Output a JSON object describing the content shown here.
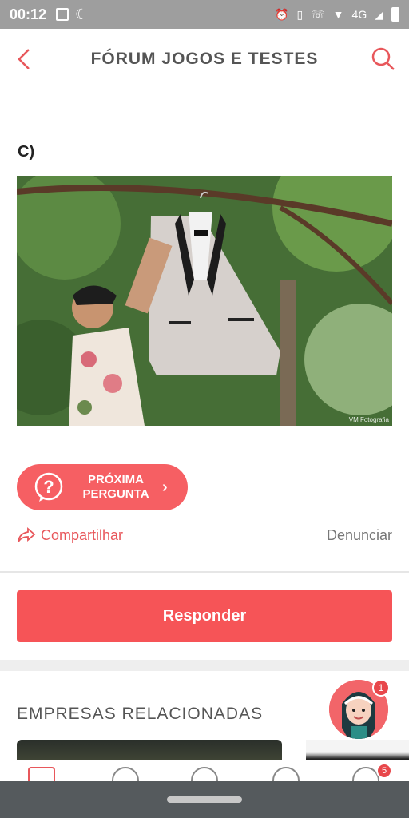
{
  "status_bar": {
    "time": "00:12",
    "network": "4G"
  },
  "app_bar": {
    "title": "FÓRUM JOGOS E TESTES"
  },
  "post": {
    "option_label": "C)",
    "photo_credit": "VM Fotografia"
  },
  "next_question": {
    "line1": "PRÓXIMA",
    "line2": "PERGUNTA"
  },
  "actions": {
    "share": "Compartilhar",
    "report": "Denunciar"
  },
  "reply_button": "Responder",
  "related": {
    "title": "EMPRESAS RELACIONADAS"
  },
  "assistant_badge": "1",
  "nav_badge": "5",
  "colors": {
    "accent": "#f65457",
    "status_bar": "#9e9e9e",
    "system_nav": "#555a5d"
  }
}
